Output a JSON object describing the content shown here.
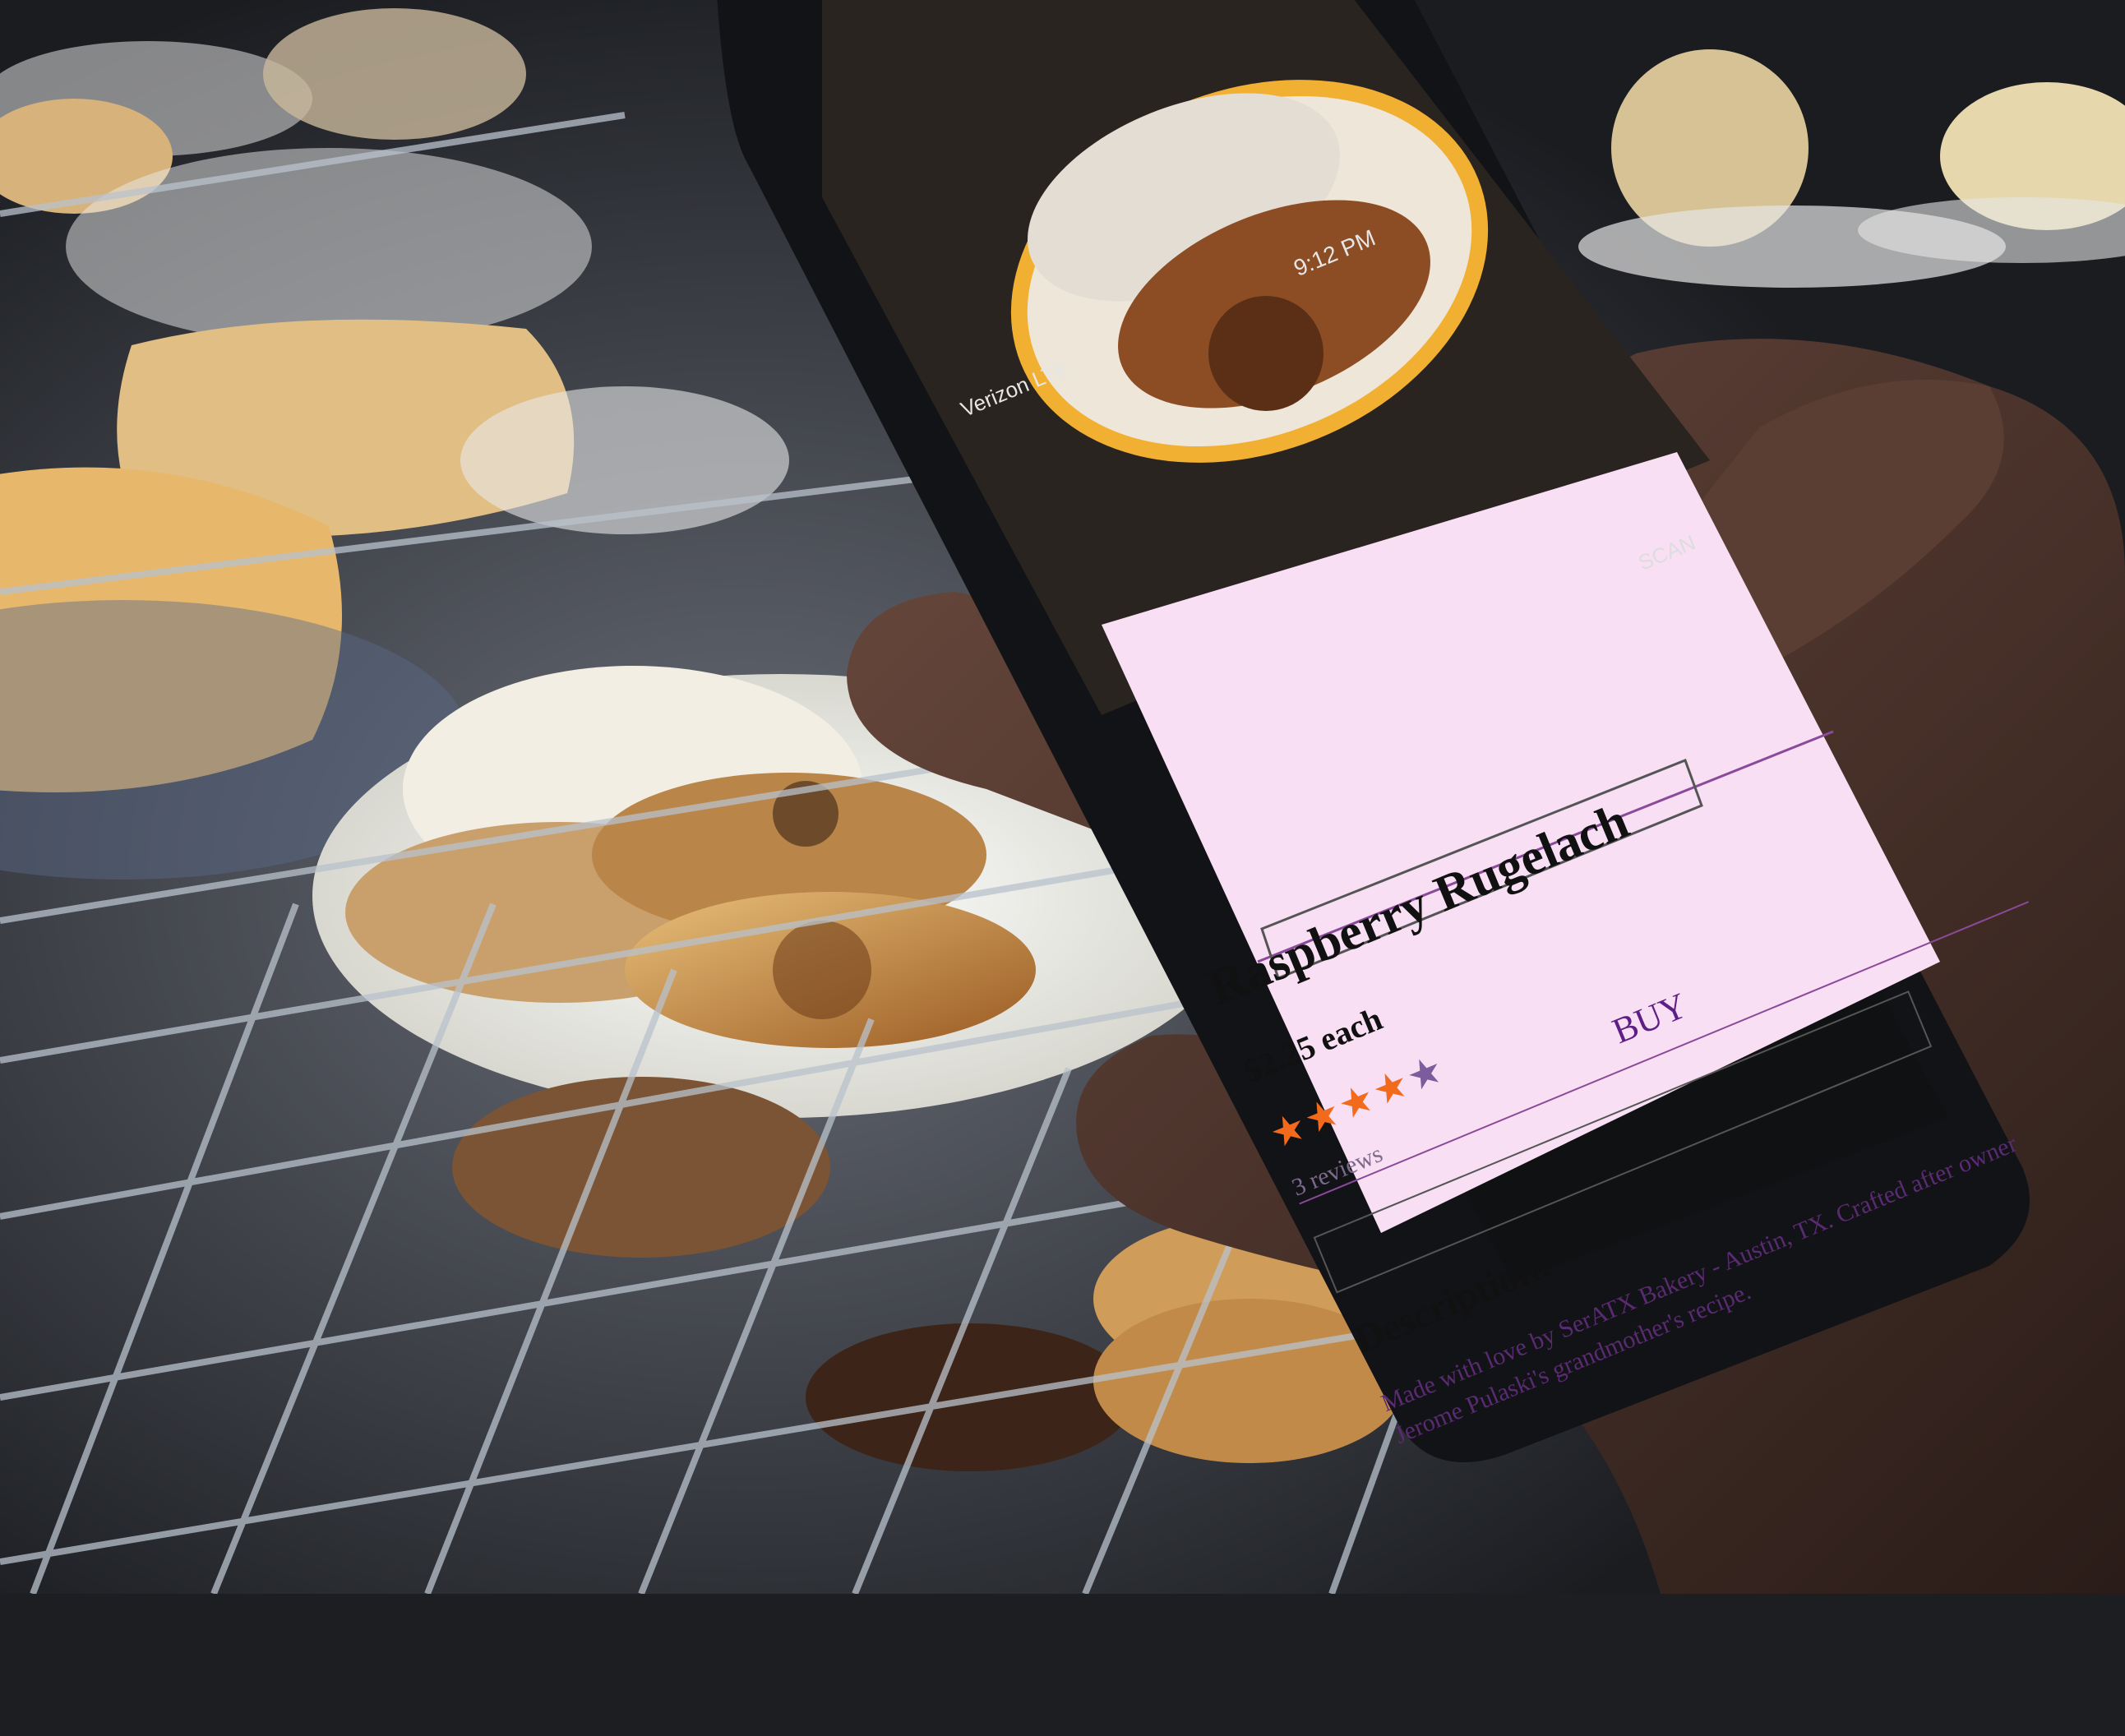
{
  "status_bar": {
    "carrier": "Verizon",
    "network": "LTE",
    "time": "9:12 PM"
  },
  "camera": {
    "scan_label": "SCAN"
  },
  "product": {
    "title": "Raspberry Rugelach",
    "price": "$2.25 each",
    "rating": 4,
    "rating_max": 5,
    "reviews": "3 reviews",
    "buy_label": "BUY",
    "description_heading": "Description:",
    "description": "Made with love by SerATX Bakery - Austin, TX. Crafted after owner Jerome Pulaski's grandmother's recipe."
  },
  "colors": {
    "card_background": "#f8dff4",
    "star_active": "#f26b1d",
    "star_inactive": "#7b5c9c",
    "buy_text": "#5d1f86"
  }
}
